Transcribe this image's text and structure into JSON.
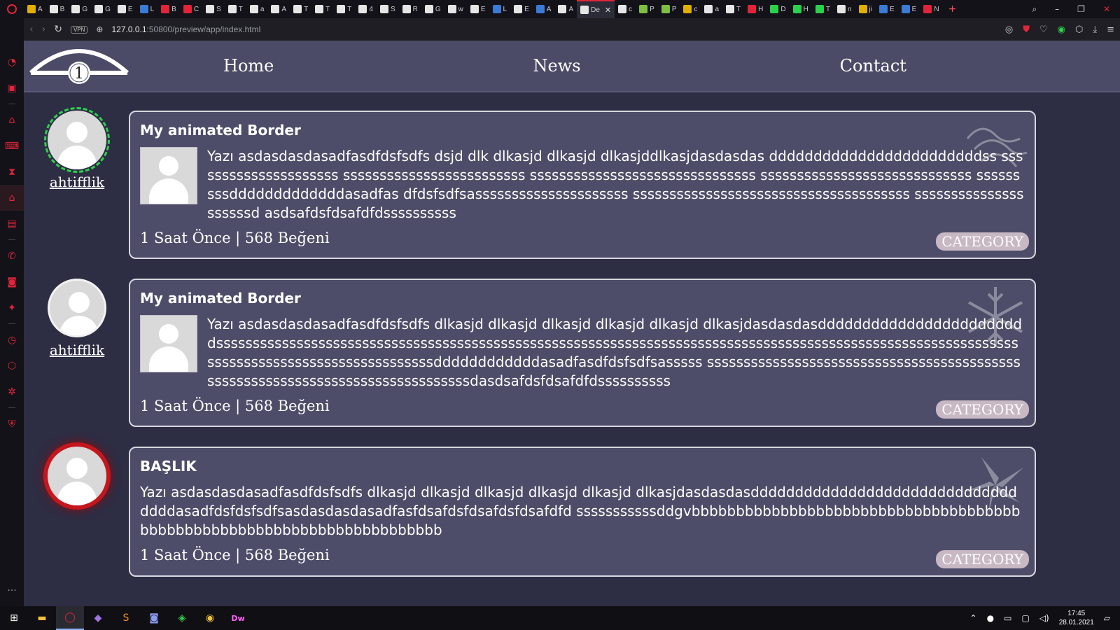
{
  "browser": {
    "tabs": [
      {
        "label": "A",
        "color": "#e0b000"
      },
      {
        "label": "B",
        "color": "#e6e6e6"
      },
      {
        "label": "G",
        "color": "#e6e6e6"
      },
      {
        "label": "G",
        "color": "#e6e6e6"
      },
      {
        "label": "E",
        "color": "#e6e6e6"
      },
      {
        "label": "L",
        "color": "#3a7bd5"
      },
      {
        "label": "B",
        "color": "#e2243a"
      },
      {
        "label": "C",
        "color": "#e2243a"
      },
      {
        "label": "S",
        "color": "#e6e6e6"
      },
      {
        "label": "T",
        "color": "#e6e6e6"
      },
      {
        "label": "a",
        "color": "#e6e6e6"
      },
      {
        "label": "A",
        "color": "#e6e6e6"
      },
      {
        "label": "T",
        "color": "#e6e6e6"
      },
      {
        "label": "T",
        "color": "#e6e6e6"
      },
      {
        "label": "T",
        "color": "#e6e6e6"
      },
      {
        "label": "4",
        "color": "#e6e6e6"
      },
      {
        "label": "S",
        "color": "#e6e6e6"
      },
      {
        "label": "R",
        "color": "#e6e6e6"
      },
      {
        "label": "G",
        "color": "#e6e6e6"
      },
      {
        "label": "w",
        "color": "#e6e6e6"
      },
      {
        "label": "E",
        "color": "#e6e6e6"
      },
      {
        "label": "L",
        "color": "#3a7bd5"
      },
      {
        "label": "E",
        "color": "#e6e6e6"
      },
      {
        "label": "A",
        "color": "#3a7bd5"
      },
      {
        "label": "A",
        "color": "#e6e6e6"
      }
    ],
    "active_tab": "De",
    "tabs_after": [
      {
        "label": "c",
        "color": "#e6e6e6"
      },
      {
        "label": "P",
        "color": "#7fbf3f"
      },
      {
        "label": "P",
        "color": "#7fbf3f"
      },
      {
        "label": "c",
        "color": "#e0b000"
      },
      {
        "label": "a",
        "color": "#e6e6e6"
      },
      {
        "label": "T",
        "color": "#e6e6e6"
      },
      {
        "label": "H",
        "color": "#e2243a"
      },
      {
        "label": "D",
        "color": "#2ad24a"
      },
      {
        "label": "H",
        "color": "#2ad24a"
      },
      {
        "label": "T",
        "color": "#2ad24a"
      },
      {
        "label": "n",
        "color": "#e6e6e6"
      },
      {
        "label": "ji",
        "color": "#e0b000"
      },
      {
        "label": "E",
        "color": "#3a7bd5"
      },
      {
        "label": "E",
        "color": "#3a7bd5"
      },
      {
        "label": "N",
        "color": "#e2243a"
      }
    ],
    "url_host": "127.0.0.1",
    "url_rest": ":50800/preview/app/index.html",
    "vpn_label": "VPN"
  },
  "site": {
    "nav": [
      "Home",
      "News",
      "Contact"
    ],
    "logo_number": "1"
  },
  "posts": [
    {
      "username": "ahtifflik",
      "title": "My animated Border",
      "text": "Yazı asdasdasdasadfasdfdsfsdfs dsjd dlk dlkasjd dlkasjd dlkasjddlkasjdasdasdas ddddddddddddddddddddddddss sssssssssssssssssssss sssssssssssssssssssssssss sssssssssssssssssssssssssssssss sssssssssssssssssssssssssssss sssssssssdddddddddddddasadfas dfdsfsdfsasssssssssssssssssssss ssssssssssssssssssssssssssssssssssssss sssssssssssssssssssssd asdsafdsfdsafdfdssssssssss",
      "meta": "1 Saat Önce | 568 Beğeni",
      "category": "CATEGORY",
      "has_thumb": true
    },
    {
      "username": "ahtifflik",
      "title": "My animated Border",
      "text": "Yazı asdasdasdasadfasdfdsfsdfs dlkasjd dlkasjd dlkasjd dlkasjd dlkasjd dlkasjdasdasdasddddddddddddddddddddddddsssssssssssssssssssssssssssssssssssssssssssssssssssssssssssssssssssssssssssssssssssssssssssssssssssssssssssssssssssssssssssssssssssssssssssssddddddddddddasadfasdfdsfsdfsasssss sssssssssssssssssssssssssssssssssssssssssssssssssssssssssssssssssssssssssssssssdasdsafdsfdsafdfdssssssssss",
      "meta": "1 Saat Önce | 568 Beğeni",
      "category": "CATEGORY",
      "has_thumb": true
    },
    {
      "username": "",
      "title": "BAŞLIK",
      "text": "Yazı asdasdasdasadfasdfdsfsdfs dlkasjd dlkasjd dlkasjd dlkasjd dlkasjd dlkasjdasdasdasddddddddddddddddddddddddddddddddddasadfdsfdsfsdfsasdasdasdasadfasfdsafdsfdsafdsfdsafdfd sssssssssssddgvbbbbbbbbbbbbbbbbbbbbbbbbbbbbbbbbbbbbbbbbbbbbbbbbbbbbbbbbbbbbbbbbbbbbbbb",
      "meta": "1 Saat Önce | 568 Beğeni",
      "category": "CATEGORY",
      "has_thumb": false
    }
  ],
  "taskbar": {
    "time": "17:45",
    "date": "28.01.2021",
    "apps": [
      "windows-start",
      "file-explorer",
      "opera",
      "visual-studio",
      "sublime-text",
      "discord",
      "gpu-tool",
      "chrome",
      "dreamweaver"
    ]
  },
  "colors": {
    "page_bg": "#2d2d44",
    "header_bg": "#4b4b68",
    "card_bg": "#4d4d6a",
    "accent_red": "#e2243a",
    "ring_green": "#2ad24a"
  }
}
